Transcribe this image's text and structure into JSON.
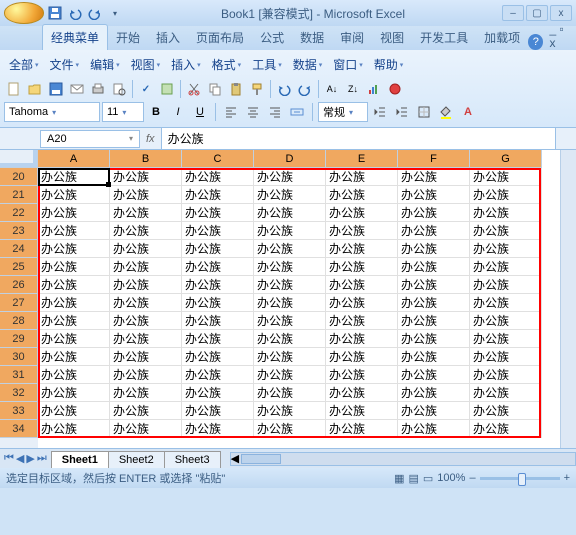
{
  "title": "Book1 [兼容模式] - Microsoft Excel",
  "tabs": [
    "经典菜单",
    "开始",
    "插入",
    "页面布局",
    "公式",
    "数据",
    "审阅",
    "视图",
    "开发工具",
    "加载项"
  ],
  "activeTab": 0,
  "menus": [
    "全部",
    "文件",
    "编辑",
    "视图",
    "插入",
    "格式",
    "工具",
    "数据",
    "窗口",
    "帮助"
  ],
  "font": {
    "name": "Tahoma",
    "size": "11",
    "style": "常规"
  },
  "namebox": "A20",
  "formula": "办公族",
  "columns": [
    "A",
    "B",
    "C",
    "D",
    "E",
    "F",
    "G"
  ],
  "rowStart": 20,
  "rowEnd": 34,
  "cellValue": "办公族",
  "sheets": [
    "Sheet1",
    "Sheet2",
    "Sheet3"
  ],
  "activeSheet": 0,
  "status": "选定目标区域，然后按 ENTER 或选择 \"粘贴\"",
  "zoom": "100%",
  "chart_data": null
}
